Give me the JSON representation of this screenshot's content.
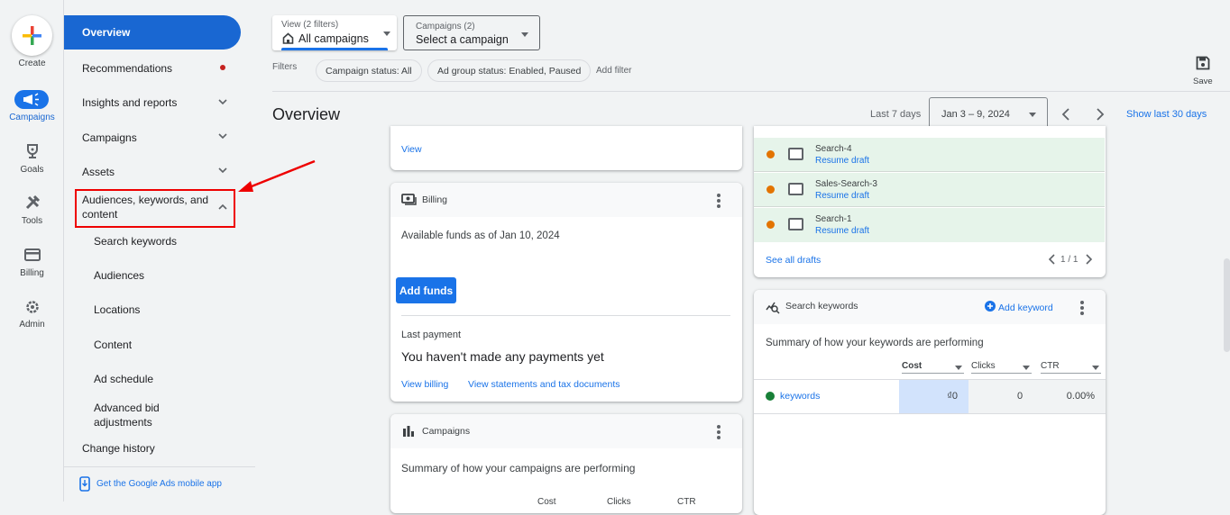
{
  "rail": {
    "create_label": "Create",
    "items": [
      {
        "label": "Campaigns",
        "icon": "megaphone-icon",
        "active": true
      },
      {
        "label": "Goals",
        "icon": "trophy-icon"
      },
      {
        "label": "Tools",
        "icon": "tools-icon"
      },
      {
        "label": "Billing",
        "icon": "credit-card-icon"
      },
      {
        "label": "Admin",
        "icon": "gear-icon"
      }
    ]
  },
  "nav": {
    "items": [
      {
        "label": "Overview",
        "active": true
      },
      {
        "label": "Recommendations",
        "badge": "red-dot"
      },
      {
        "label": "Insights and reports",
        "expandable": true
      },
      {
        "label": "Campaigns",
        "expandable": true
      },
      {
        "label": "Assets",
        "expandable": true
      },
      {
        "label": "Audiences, keywords, and content",
        "expanded": true,
        "highlighted": true
      }
    ],
    "subitems": [
      "Search keywords",
      "Audiences",
      "Locations",
      "Content",
      "Ad schedule",
      "Advanced bid adjustments"
    ],
    "change_history": "Change history",
    "mobile_app": "Get the Google Ads mobile app"
  },
  "topbar": {
    "view": {
      "label": "View (2 filters)",
      "value": "All campaigns"
    },
    "campaigns": {
      "label": "Campaigns (2)",
      "value": "Select a campaign"
    },
    "filters_label": "Filters",
    "chips": [
      "Campaign status: All",
      "Ad group status: Enabled, Paused"
    ],
    "add_filter": "Add filter",
    "save_label": "Save"
  },
  "header": {
    "title": "Overview",
    "range_label": "Last 7 days",
    "date_range": "Jan 3 – 9, 2024",
    "show_last_30": "Show last 30 days"
  },
  "cards": {
    "top_partial": {
      "link": "View"
    },
    "billing": {
      "title": "Billing",
      "available_funds": "Available funds as of Jan 10, 2024",
      "add_funds": "Add funds",
      "last_payment_label": "Last payment",
      "last_payment_value": "You haven't made any payments yet",
      "links": [
        "View billing",
        "View statements and tax documents"
      ]
    },
    "campaigns": {
      "title": "Campaigns",
      "summary": "Summary of how your campaigns are performing",
      "columns": [
        "Cost",
        "Clicks",
        "CTR"
      ]
    },
    "drafts": {
      "rows": [
        {
          "name": "Search-4",
          "action": "Resume draft"
        },
        {
          "name": "Sales-Search-3",
          "action": "Resume draft"
        },
        {
          "name": "Search-1",
          "action": "Resume draft"
        }
      ],
      "see_all": "See all drafts",
      "pagination": "1 / 1"
    },
    "search_keywords": {
      "title": "Search keywords",
      "add_keyword": "Add keyword",
      "summary": "Summary of how your keywords are performing",
      "columns": [
        "Cost",
        "Clicks",
        "CTR"
      ],
      "row": {
        "label": "keywords",
        "cost": "₫0",
        "clicks": "0",
        "ctr": "0.00%"
      }
    }
  },
  "colors": {
    "accent": "#1a73e8",
    "nav_active": "#1967d2",
    "draft_bg": "#e6f4ea",
    "highlight": "#ff0000"
  }
}
